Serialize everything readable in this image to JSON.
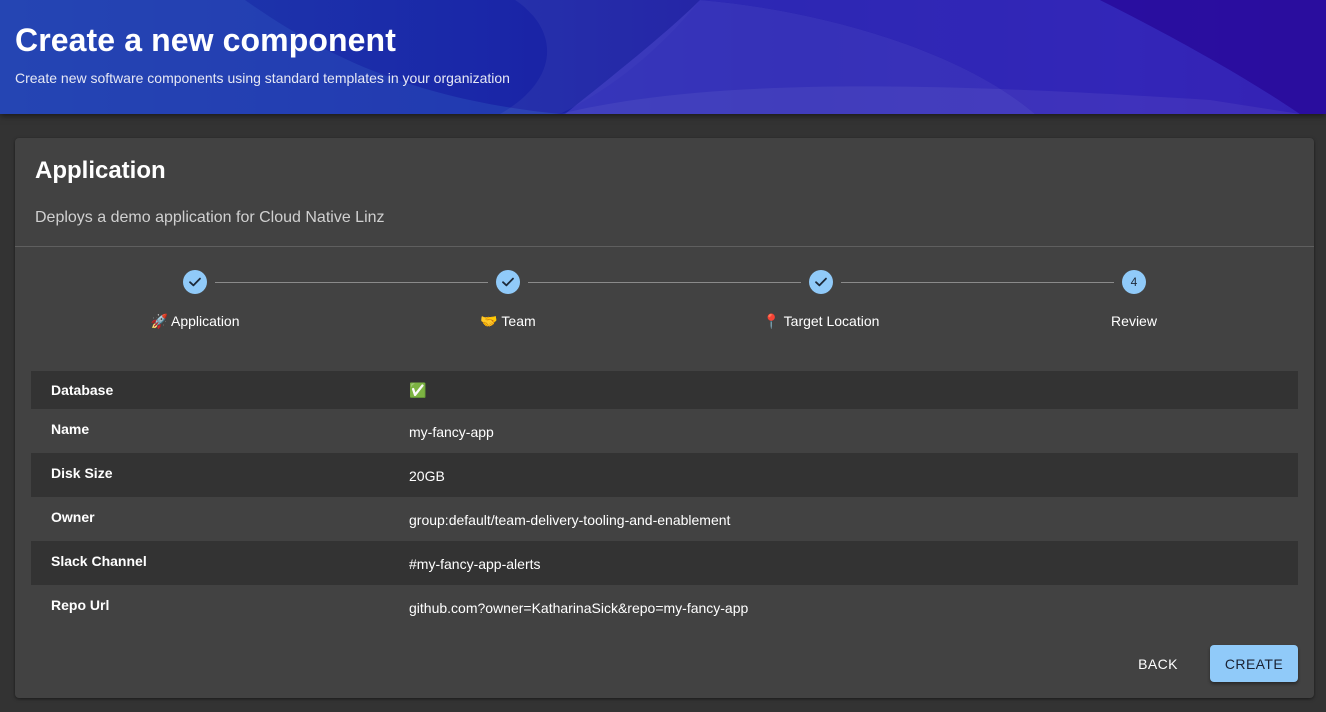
{
  "header": {
    "title": "Create a new component",
    "subtitle": "Create new software components using standard templates in your organization"
  },
  "template": {
    "title": "Application",
    "description": "Deploys a demo application for Cloud Native Linz"
  },
  "stepper": {
    "steps": [
      {
        "label": "🚀 Application",
        "state": "completed",
        "icon": "check-icon"
      },
      {
        "label": "🤝 Team",
        "state": "completed",
        "icon": "check-icon"
      },
      {
        "label": "📍 Target Location",
        "state": "completed",
        "icon": "check-icon"
      },
      {
        "label": "Review",
        "state": "active",
        "number": "4"
      }
    ]
  },
  "review": {
    "rows": [
      {
        "key": "Database",
        "value": "✅"
      },
      {
        "key": "Name",
        "value": "my-fancy-app"
      },
      {
        "key": "Disk Size",
        "value": "20GB"
      },
      {
        "key": "Owner",
        "value": "group:default/team-delivery-tooling-and-enablement"
      },
      {
        "key": "Slack Channel",
        "value": "#my-fancy-app-alerts"
      },
      {
        "key": "Repo Url",
        "value": "github.com?owner=KatharinaSick&repo=my-fancy-app"
      }
    ]
  },
  "actions": {
    "back_label": "BACK",
    "create_label": "CREATE"
  },
  "colors": {
    "accent": "#90caf9",
    "card_bg": "#424242",
    "page_bg": "#333333"
  }
}
